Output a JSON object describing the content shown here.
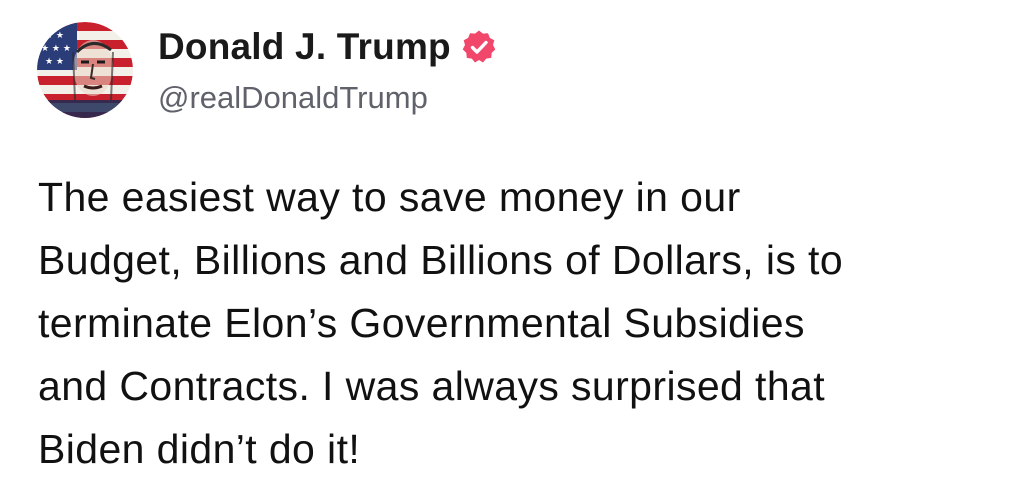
{
  "author": {
    "display_name": "Donald J. Trump",
    "handle": "@realDonaldTrump",
    "verified": true,
    "verified_color": "#f0476b",
    "avatar_icon": "flag-portrait-avatar"
  },
  "post": {
    "lines": [
      "The easiest way to save money in our",
      "Budget, Billions and Billions of Dollars, is to",
      "terminate Elon’s Governmental Subsidies",
      "and Contracts. I was always surprised that",
      "Biden didn’t do it!"
    ]
  }
}
